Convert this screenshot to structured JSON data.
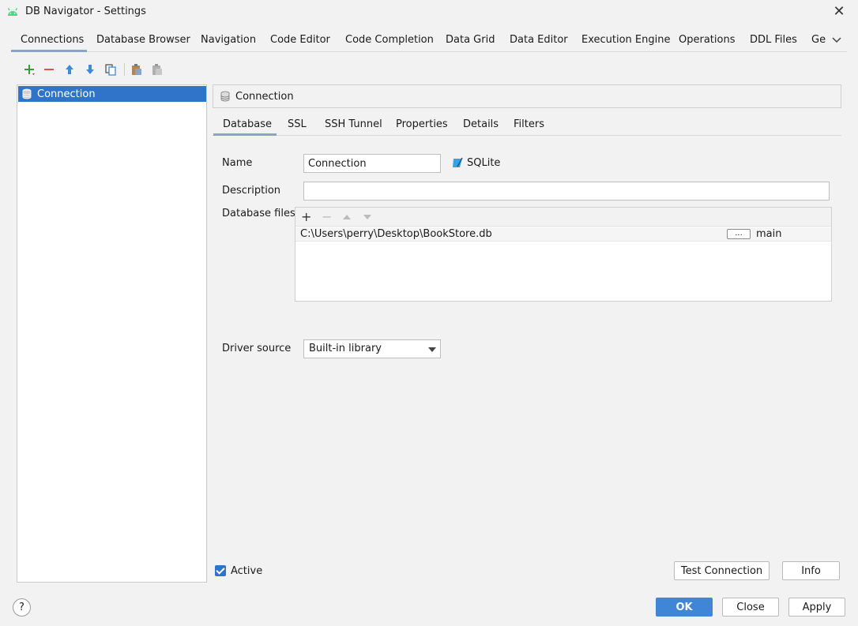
{
  "window": {
    "title": "DB Navigator - Settings"
  },
  "top_tabs": [
    {
      "label": "Connections"
    },
    {
      "label": "Database Browser"
    },
    {
      "label": "Navigation"
    },
    {
      "label": "Code Editor"
    },
    {
      "label": "Code Completion"
    },
    {
      "label": "Data Grid"
    },
    {
      "label": "Data Editor"
    },
    {
      "label": "Execution Engine"
    },
    {
      "label": "Operations"
    },
    {
      "label": "DDL Files"
    },
    {
      "label": "Ge"
    }
  ],
  "toolbar_icons": [
    "add-icon",
    "remove-icon",
    "move-up-icon",
    "move-down-icon",
    "copy-icon",
    "paste-icon",
    "clipboard-icon"
  ],
  "connections_list": [
    {
      "label": "Connection"
    }
  ],
  "connection_header": {
    "label": "Connection"
  },
  "inner_tabs": [
    {
      "label": "Database"
    },
    {
      "label": "SSL"
    },
    {
      "label": "SSH Tunnel"
    },
    {
      "label": "Properties"
    },
    {
      "label": "Details"
    },
    {
      "label": "Filters"
    }
  ],
  "form": {
    "name_label": "Name",
    "name_value": "Connection",
    "db_type": "SQLite",
    "description_label": "Description",
    "description_value": "",
    "db_files_label": "Database files",
    "db_files": [
      {
        "path": "C:\\Users\\perry\\Desktop\\BookStore.db",
        "browse": "...",
        "alias": "main"
      }
    ],
    "driver_source_label": "Driver source",
    "driver_source_value": "Built-in library"
  },
  "footer": {
    "active_label": "Active",
    "active_checked": true,
    "test_connection": "Test Connection",
    "info": "Info",
    "ok": "OK",
    "close": "Close",
    "apply": "Apply",
    "help": "?"
  },
  "colors": {
    "selection": "#2f74c8",
    "primary_button": "#3f86d6",
    "add_green": "#3c9a3c",
    "remove_red": "#d9534f",
    "arrow_blue": "#3d8bd8"
  }
}
